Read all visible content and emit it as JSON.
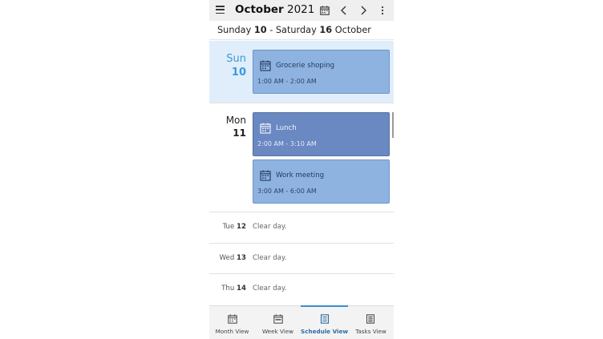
{
  "header": {
    "month": "October",
    "year": "2021"
  },
  "range": {
    "start_day": "Sunday",
    "start_num": "10",
    "separator": "-",
    "end_day": "Saturday",
    "end_num": "16",
    "end_month": "October"
  },
  "days": [
    {
      "name": "Sun",
      "num": "10",
      "events": [
        {
          "title": "Grocerie shoping",
          "time": "1:00 AM - 2:00 AM"
        }
      ]
    },
    {
      "name": "Mon",
      "num": "11",
      "events": [
        {
          "title": "Lunch",
          "time": "2:00 AM - 3:10 AM"
        },
        {
          "title": "Work meeting",
          "time": "3:00 AM - 6:00 AM"
        }
      ]
    }
  ],
  "clear_days": [
    {
      "name": "Tue",
      "num": "12",
      "text": "Clear day."
    },
    {
      "name": "Wed",
      "num": "13",
      "text": "Clear day."
    },
    {
      "name": "Thu",
      "num": "14",
      "text": "Clear day."
    }
  ],
  "tabs": [
    {
      "label": "Month View"
    },
    {
      "label": "Week View"
    },
    {
      "label": "Schedule View"
    },
    {
      "label": "Tasks View"
    }
  ],
  "icons": {
    "menu": "hamburger-menu-icon",
    "calendar": "calendar-icon",
    "prev": "chevron-left-icon",
    "next": "chevron-right-icon",
    "more": "more-vertical-icon"
  },
  "colors": {
    "today_bg": "#dfeefa",
    "today_text": "#3a9ad9",
    "event_light": "#8fb3e0",
    "event_dark": "#6a88c2",
    "tab_active": "#3b8ed3"
  }
}
